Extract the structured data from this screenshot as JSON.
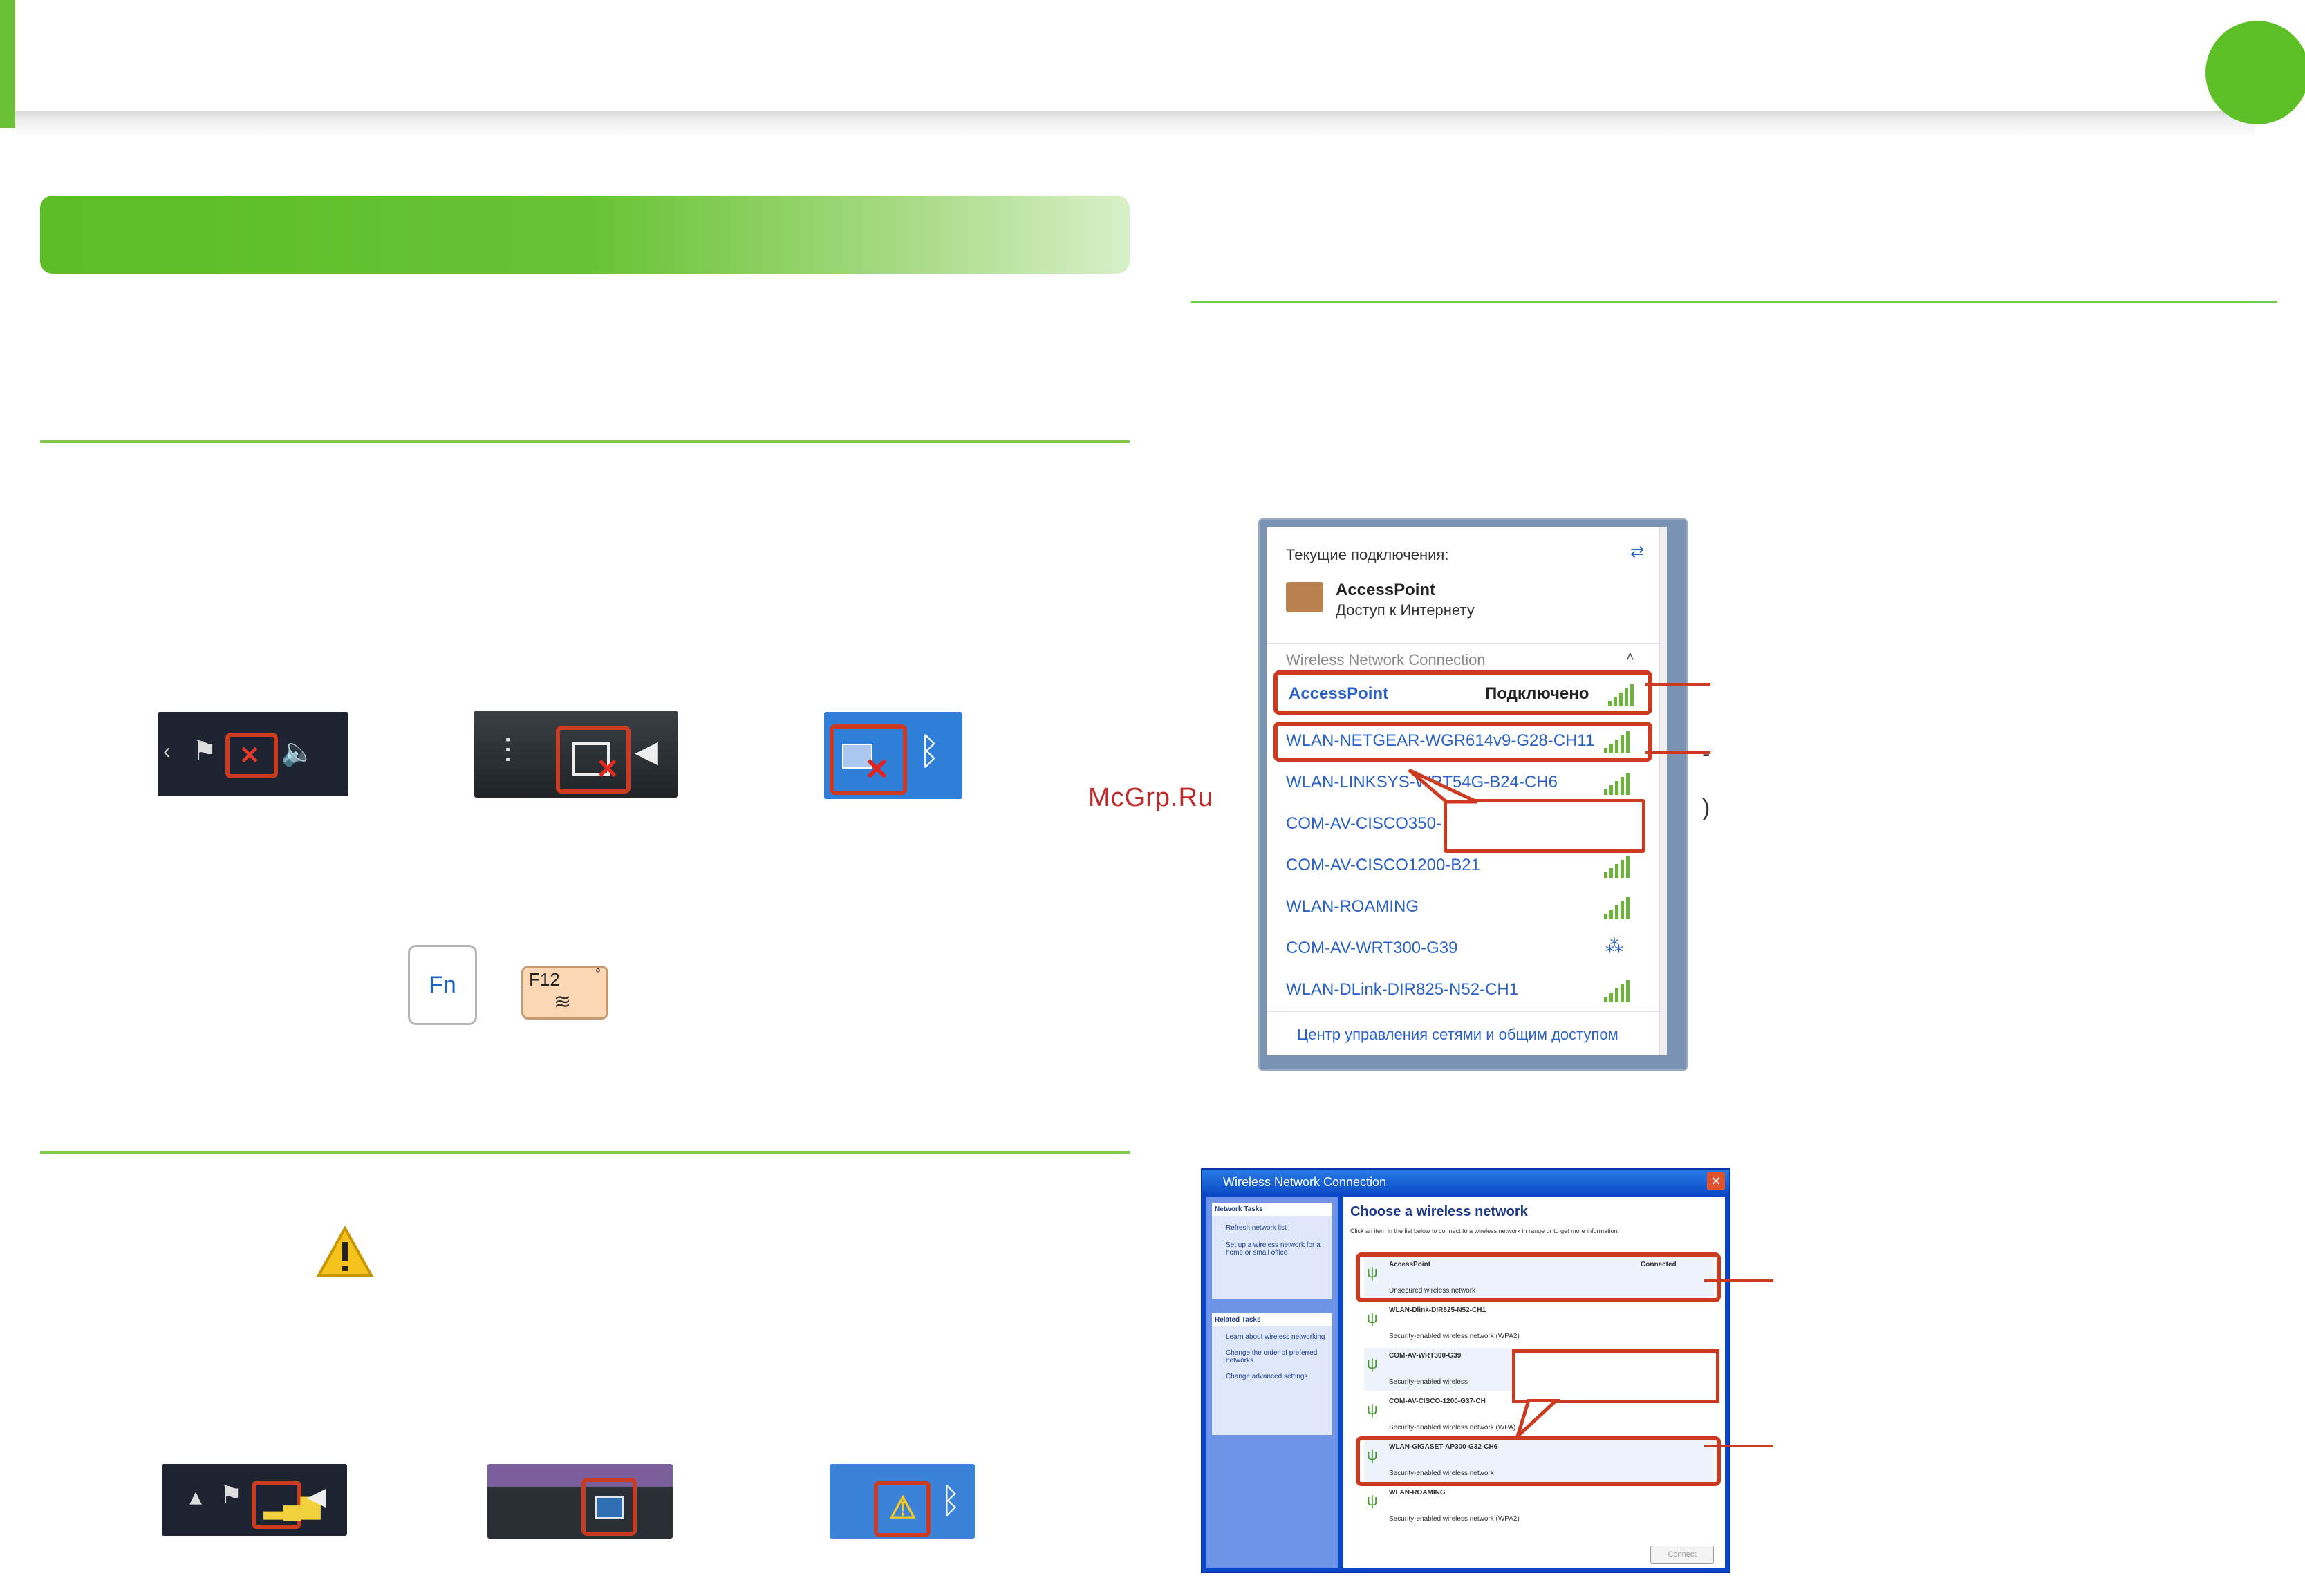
{
  "colors": {
    "accent_green": "#6cc137",
    "highlight_red": "#cc3b1f",
    "link_blue": "#2a62c8"
  },
  "watermark": "McGrp.Ru",
  "keys": {
    "fn": "Fn",
    "f12": "F12"
  },
  "vista_panel": {
    "current_connections": "Текущие подключения:",
    "connection_name": "AccessPoint",
    "connection_status": "Доступ к Интернету",
    "section": "Wireless Network Connection",
    "connected_network": "AccessPoint",
    "connected_label": "Подключено",
    "networks": [
      "WLAN-NETGEAR-WGR614v9-G28-CH11",
      "WLAN-LINKSYS-WRT54G-B24-CH6",
      "COM-AV-CISCO350-",
      "COM-AV-CISCO1200-B21",
      "WLAN-ROAMING",
      "COM-AV-WRT300-G39",
      "WLAN-DLink-DIR825-N52-CH1"
    ],
    "footer": "Центр управления сетями и общим доступом"
  },
  "xp_panel": {
    "title": "Wireless Network Connection",
    "heading": "Choose a wireless network",
    "intro": "Click an item in the list below to connect to a wireless network in range or to get more information.",
    "network_tasks_title": "Network Tasks",
    "network_tasks": [
      "Refresh network list",
      "Set up a wireless network for a home or small office"
    ],
    "related_tasks_title": "Related Tasks",
    "related_tasks": [
      "Learn about wireless networking",
      "Change the order of preferred networks",
      "Change advanced settings"
    ],
    "networks": [
      {
        "name": "AccessPoint",
        "status": "Connected",
        "security": "Unsecured wireless network"
      },
      {
        "name": "WLAN-Dlink-DIR825-N52-CH1",
        "status": "",
        "security": "Security-enabled wireless network (WPA2)"
      },
      {
        "name": "COM-AV-WRT300-G39",
        "status": "",
        "security": "Security-enabled wireless"
      },
      {
        "name": "COM-AV-CISCO-1200-G37-CH",
        "status": "",
        "security": "Security-enabled wireless network (WPA)"
      },
      {
        "name": "WLAN-GIGASET-AP300-G32-CH6",
        "status": "",
        "security": "Security-enabled wireless network"
      },
      {
        "name": "WLAN-ROAMING",
        "status": "",
        "security": "Security-enabled wireless network (WPA2)"
      }
    ],
    "connect_button": "Connect"
  }
}
